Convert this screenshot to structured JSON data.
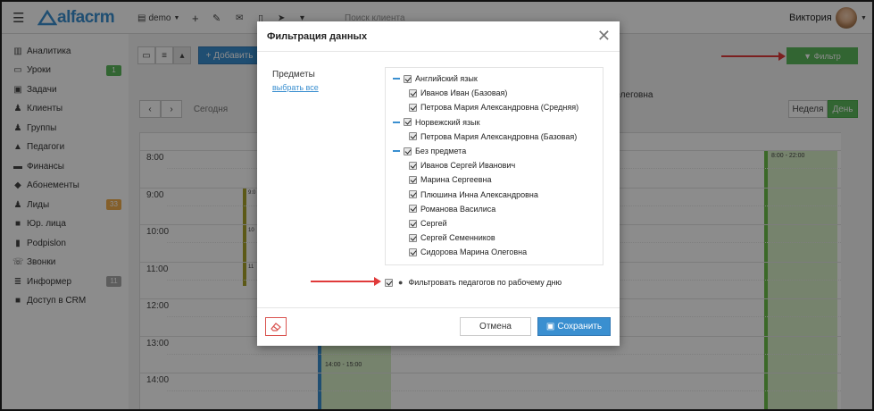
{
  "navbar": {
    "logo_text": "alfacrm",
    "branch": "demo",
    "search_placeholder": "Поиск клиента",
    "user_name": "Виктория"
  },
  "sidebar": {
    "items": [
      {
        "label": "Аналитика",
        "icon": "chart-icon",
        "badge": ""
      },
      {
        "label": "Уроки",
        "icon": "calendar-icon",
        "badge": "1"
      },
      {
        "label": "Задачи",
        "icon": "tasks-icon",
        "badge": ""
      },
      {
        "label": "Клиенты",
        "icon": "user-icon",
        "badge": ""
      },
      {
        "label": "Группы",
        "icon": "users-icon",
        "badge": ""
      },
      {
        "label": "Педагоги",
        "icon": "graduation-cap-icon",
        "badge": ""
      },
      {
        "label": "Финансы",
        "icon": "money-icon",
        "badge": ""
      },
      {
        "label": "Абонементы",
        "icon": "tag-icon",
        "badge": ""
      },
      {
        "label": "Лиды",
        "icon": "user-plus-icon",
        "badge": "33"
      },
      {
        "label": "Юр. лица",
        "icon": "briefcase-icon",
        "badge": ""
      },
      {
        "label": "Podpislon",
        "icon": "file-icon",
        "badge": ""
      },
      {
        "label": "Звонки",
        "icon": "phone-icon",
        "badge": ""
      },
      {
        "label": "Информер",
        "icon": "list-icon",
        "badge": "11"
      },
      {
        "label": "Доступ в CRM",
        "icon": "lock-icon",
        "badge": ""
      }
    ],
    "badge_colors": {
      "1": "#5cb85c",
      "33": "#f0ad4e",
      "11": "#aaaaaa"
    }
  },
  "toolbar": {
    "add_label": "+ Добавить",
    "today_label": "Сегодня",
    "week_label": "Неделя",
    "day_label": "День",
    "filter_label": "▼ Фильтр",
    "teacher_fragment": "Олеговна"
  },
  "calendar": {
    "hours": [
      "8:00",
      "9:00",
      "10:00",
      "11:00",
      "12:00",
      "13:00",
      "14:00"
    ],
    "event_a_time": "14:00 - 15:00",
    "event_b_time": "8:00 - 22:00",
    "mini_labels": [
      "9:0",
      "10",
      "11"
    ]
  },
  "modal": {
    "title": "Фильтрация данных",
    "subjects_label": "Предметы",
    "select_all": "выбрать все",
    "tree": [
      {
        "label": "Английский язык",
        "level": 0
      },
      {
        "label": "Иванов Иван (Базовая)",
        "level": 1
      },
      {
        "label": "Петрова Мария Александровна (Средняя)",
        "level": 1
      },
      {
        "label": "Норвежский язык",
        "level": 0
      },
      {
        "label": "Петрова Мария Александровна (Базовая)",
        "level": 1
      },
      {
        "label": "Без предмета",
        "level": 0
      },
      {
        "label": "Иванов Сергей Иванович",
        "level": 1
      },
      {
        "label": "Марина Сергеевна",
        "level": 1
      },
      {
        "label": "Плюшина Инна Александровна",
        "level": 1
      },
      {
        "label": "Романова Василиса",
        "level": 1
      },
      {
        "label": "Сергей",
        "level": 1
      },
      {
        "label": "Сергей Семенников",
        "level": 1
      },
      {
        "label": "Сидорова Марина Олеговна",
        "level": 1
      }
    ],
    "filter_by_workday": "Фильтровать педагогов по рабочему дню",
    "cancel_label": "Отмена",
    "save_label": "Сохранить"
  },
  "colors": {
    "accent": "#3a8fd0",
    "green": "#5cb85c",
    "arrow": "#e03a3a",
    "danger": "#d9534f"
  }
}
